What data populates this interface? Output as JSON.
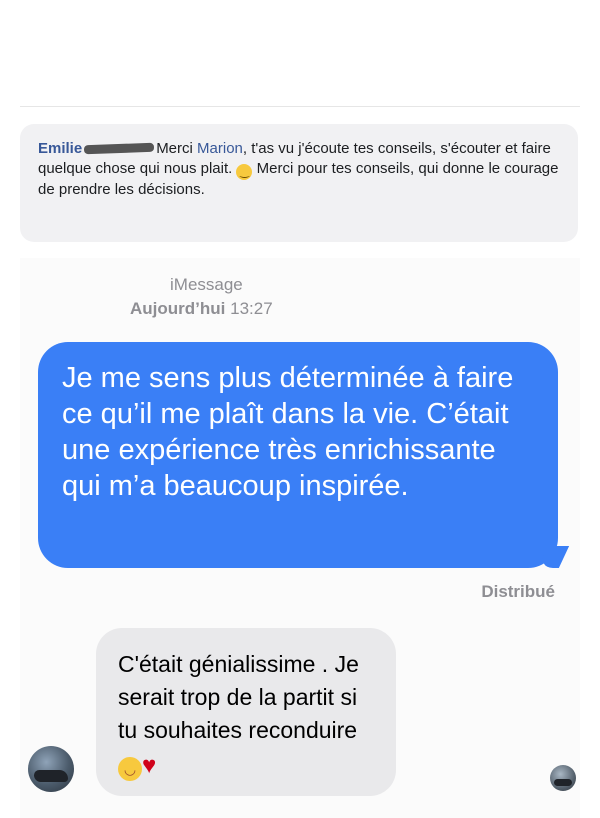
{
  "facebook_comment": {
    "author": "Emilie",
    "text_before_mention": "Merci ",
    "mention": "Marion",
    "text_after_mention": ", t'as vu j'écoute tes conseils, s'écouter et faire quelque chose qui nous plait. ",
    "emoji": "smile-emoji",
    "text_end": " Merci pour tes conseils, qui donne le courage de prendre les décisions."
  },
  "imessage": {
    "service_label": "iMessage",
    "date_prefix": "Aujourd’hui",
    "time": "13:27",
    "outgoing_message": "Je me sens plus déterminée à faire ce qu’il me plaît dans la vie. C’était une expérience très enrichissante qui m’a beaucoup inspirée.",
    "delivery_status": "Distribué",
    "incoming_message": "C'était génialissime . Je serait trop de la partit si tu souhaites reconduire",
    "incoming_emojis": [
      "smiling-blush-emoji",
      "red-heart-emoji"
    ]
  },
  "colors": {
    "outgoing_bubble": "#3a7ff6",
    "incoming_bubble": "#e9e9eb",
    "comment_author": "#385898",
    "comment_background": "#f1f1f3"
  }
}
